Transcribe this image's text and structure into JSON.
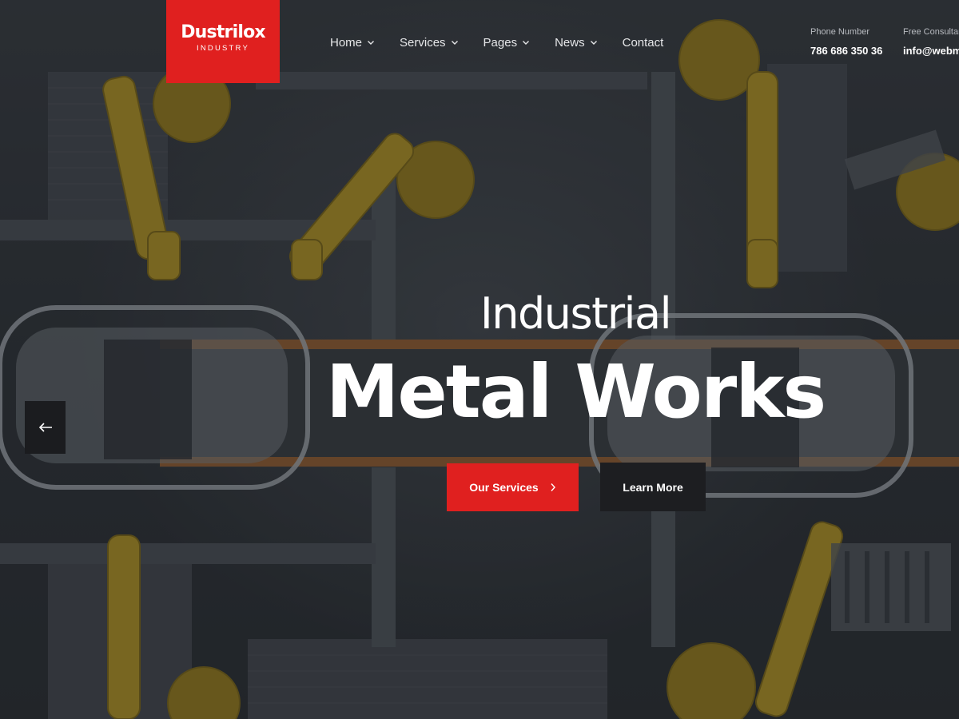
{
  "brand": {
    "name": "Dustrilox",
    "tagline": "INDUSTRY",
    "accent_color": "#e0201f"
  },
  "nav": {
    "items": [
      {
        "label": "Home",
        "has_dropdown": true
      },
      {
        "label": "Services",
        "has_dropdown": true
      },
      {
        "label": "Pages",
        "has_dropdown": true
      },
      {
        "label": "News",
        "has_dropdown": true
      },
      {
        "label": "Contact",
        "has_dropdown": false
      }
    ]
  },
  "contact": {
    "phone_label": "Phone Number",
    "phone_value": "786 686 350 36",
    "consult_label": "Free Consultan",
    "consult_value": "info@webma"
  },
  "hero": {
    "subtitle": "Industrial",
    "title": "Metal Works",
    "primary_button": "Our Services",
    "secondary_button": "Learn More",
    "prev_icon": "arrow-left-icon",
    "primary_icon": "chevron-right-icon"
  }
}
